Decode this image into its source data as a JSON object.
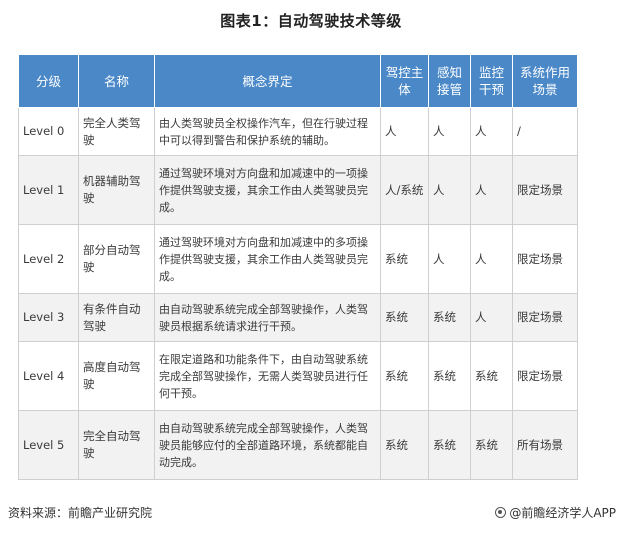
{
  "title": "图表1：自动驾驶技术等级",
  "table": {
    "headers": [
      "分级",
      "名称",
      "概念界定",
      "驾控主\n体",
      "感知\n接管",
      "监控\n干预",
      "系统作用\n场景"
    ],
    "rows": [
      [
        "Level 0",
        "完全人类驾驶",
        "由人类驾驶员全权操作汽车，但在行驶过程中可以得到警告和保护系统的辅助。",
        "人",
        "人",
        "人",
        "/"
      ],
      [
        "Level 1",
        "机器辅助驾驶",
        "通过驾驶环境对方向盘和加减速中的一项操作提供驾驶支援，其余工作由人类驾驶员完成。",
        "人/系统",
        "人",
        "人",
        "限定场景"
      ],
      [
        "Level 2",
        "部分自动驾驶",
        "通过驾驶环境对方向盘和加减速中的多项操作提供驾驶支援，其余工作由人类驾驶员完成。",
        "系统",
        "人",
        "人",
        "限定场景"
      ],
      [
        "Level 3",
        "有条件自动驾驶",
        "由自动驾驶系统完成全部驾驶操作，人类驾驶员根据系统请求进行干预。",
        "系统",
        "系统",
        "人",
        "限定场景"
      ],
      [
        "Level 4",
        "高度自动驾驶",
        "在限定道路和功能条件下，由自动驾驶系统完成全部驾驶操作，无需人类驾驶员进行任何干预。",
        "系统",
        "系统",
        "系统",
        "限定场景"
      ],
      [
        "Level 5",
        "完全自动驾驶",
        "由自动驾驶系统完成全部驾驶操作，人类驾驶员能够应付的全部道路环境，系统都能自动完成。",
        "系统",
        "系统",
        "系统",
        "所有场景"
      ]
    ]
  },
  "footer": {
    "source": "资料来源：前瞻产业研究院",
    "brand": "@前瞻经济学人APP"
  },
  "colors": {
    "header_bg": "#4a88c8",
    "row_alt_bg": "#f2f2f2"
  },
  "icons": {
    "brand": "brand-logo-icon"
  }
}
